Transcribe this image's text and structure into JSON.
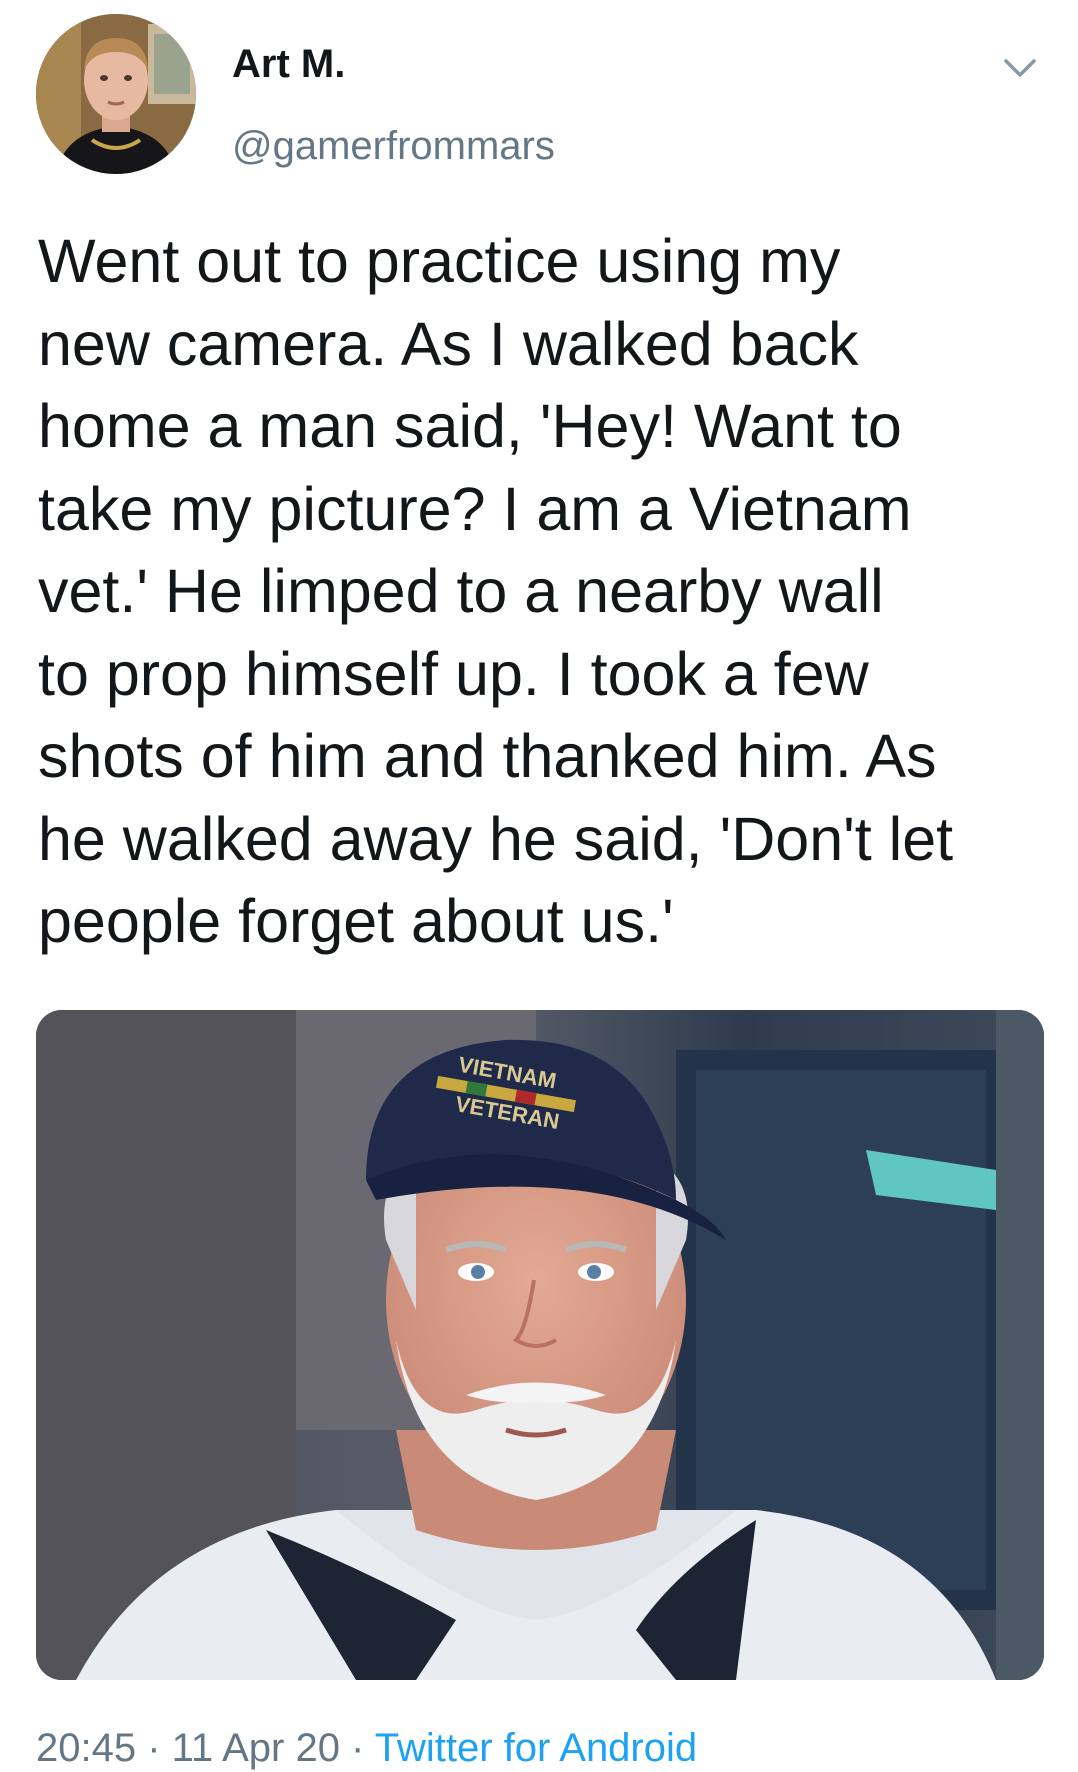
{
  "tweet": {
    "author": {
      "display_name": "Art M.",
      "handle": "@gamerfrommars"
    },
    "text": "Went out to practice using my\nnew camera. As I walked back\nhome a man said, 'Hey! Want to\ntake my picture? I am a Vietnam\nvet.' He limped to a nearby wall\nto prop himself up. I took a few\nshots of him and thanked him. As\nhe walked away he said, 'Don't let\npeople forget about us.'",
    "media": {
      "hat_text_top": "VIETNAM",
      "hat_text_bottom": "VETERAN"
    },
    "meta": {
      "time": "20:45",
      "separator_1": " · ",
      "date": "11 Apr 20",
      "separator_2": " · ",
      "source": "Twitter for Android"
    },
    "icons": {
      "menu": "chevron-down-icon"
    },
    "colors": {
      "text": "#14171a",
      "secondary": "#657786",
      "link": "#1da1f2",
      "background": "#ffffff"
    }
  }
}
